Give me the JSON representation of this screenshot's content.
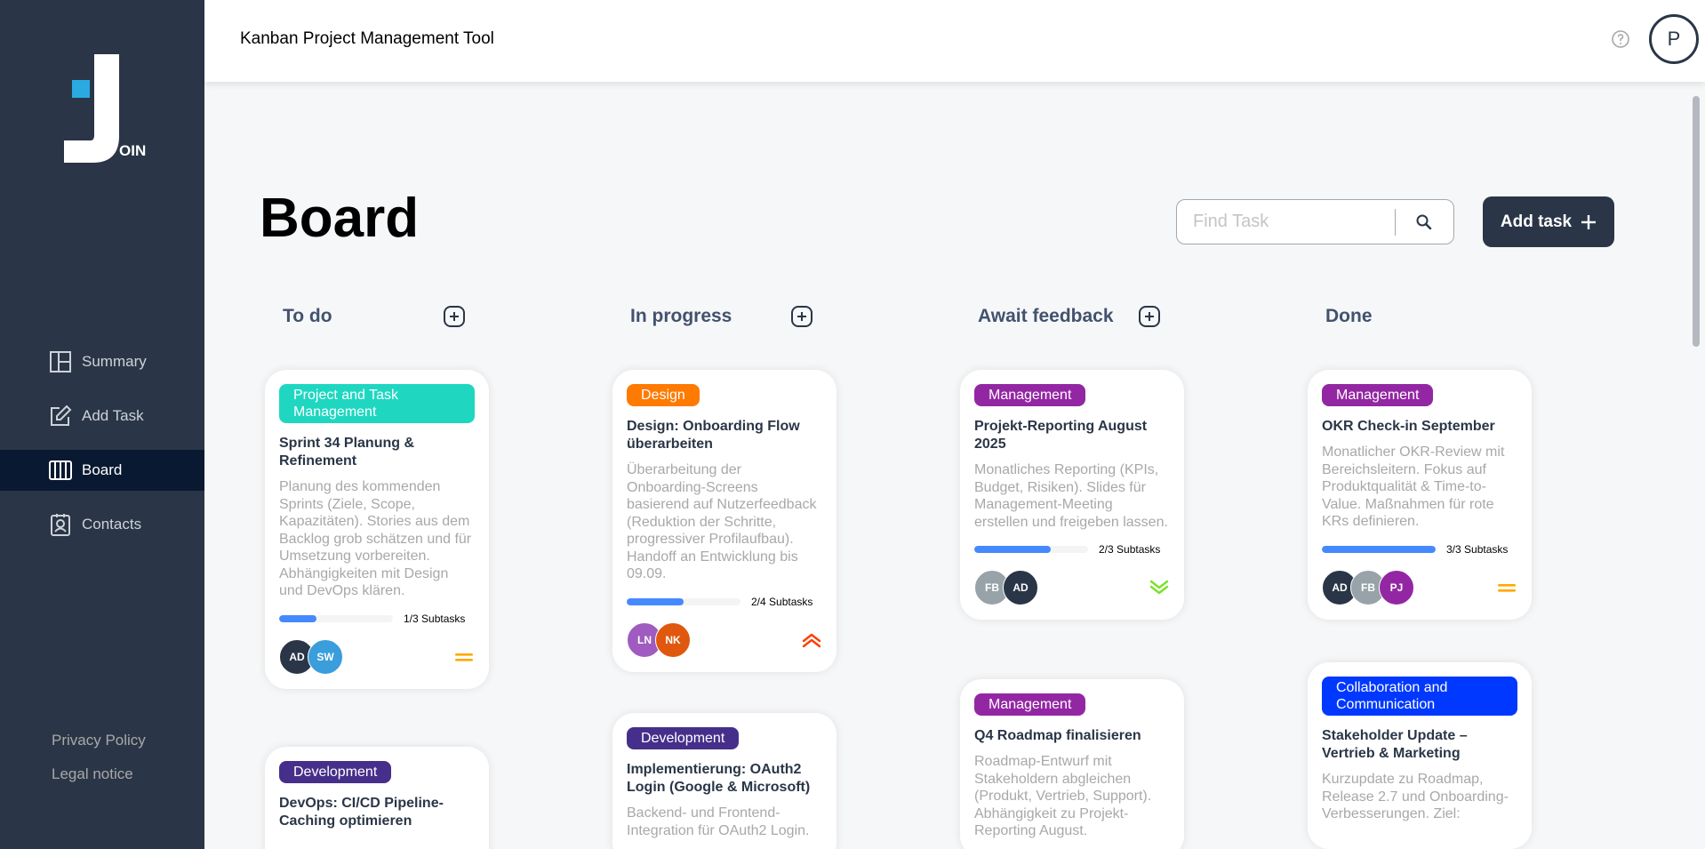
{
  "app": {
    "title": "Kanban Project Management Tool",
    "logo_text": "OIN",
    "user_initial": "P"
  },
  "sidebar": {
    "items": [
      {
        "label": "Summary",
        "icon": "summary-icon"
      },
      {
        "label": "Add Task",
        "icon": "edit-icon"
      },
      {
        "label": "Board",
        "icon": "board-icon",
        "active": true
      },
      {
        "label": "Contacts",
        "icon": "contacts-icon"
      }
    ],
    "legal": [
      "Privacy Policy",
      "Legal notice"
    ]
  },
  "board": {
    "title": "Board",
    "search_placeholder": "Find Task",
    "add_task_label": "Add task",
    "columns": [
      {
        "title": "To do"
      },
      {
        "title": "In progress"
      },
      {
        "title": "Await feedback"
      },
      {
        "title": "Done"
      }
    ]
  },
  "colors": {
    "sidebar": "#2a3647",
    "active": "#091931",
    "progress": "#4589ff",
    "prio_medium": "#ffa800",
    "prio_urgent": "#ff3d00",
    "prio_low": "#7ae229"
  },
  "cards": {
    "todo1": {
      "category": "Project and Task Management",
      "category_color": "#1fd7c1",
      "title": "Sprint 34 Planung & Refinement",
      "desc": "Planung des kommenden Sprints (Ziele, Scope, Kapazitäten). Stories aus dem Backlog grob schätzen und für Umsetzung vorbereiten. Abhängigkeiten mit Design und DevOps klären.",
      "subtasks": "1/3 Subtasks",
      "progress": 0.33,
      "assignees": [
        {
          "initials": "AD",
          "color": "#2a3647"
        },
        {
          "initials": "SW",
          "color": "#3a9ddc"
        }
      ],
      "priority": "medium"
    },
    "todo2": {
      "category": "Development",
      "category_color": "#462f8a",
      "title": "DevOps: CI/CD Pipeline-Caching optimieren"
    },
    "prog1": {
      "category": "Design",
      "category_color": "#ff7a00",
      "title": "Design: Onboarding Flow überarbeiten",
      "desc": "Überarbeitung der Onboarding-Screens basierend auf Nutzerfeedback (Reduktion der Schritte, progressiver Profilaufbau). Handoff an Entwicklung bis 09.09.",
      "subtasks": "2/4 Subtasks",
      "progress": 0.5,
      "assignees": [
        {
          "initials": "LN",
          "color": "#9f5bbf"
        },
        {
          "initials": "NK",
          "color": "#e0580e"
        }
      ],
      "priority": "urgent"
    },
    "prog2": {
      "category": "Development",
      "category_color": "#462f8a",
      "title": "Implementierung: OAuth2 Login (Google & Microsoft)",
      "desc": "Backend- und Frontend-Integration für OAuth2 Login."
    },
    "fb1": {
      "category": "Management",
      "category_color": "#9327a3",
      "title": "Projekt-Reporting August 2025",
      "desc": "Monatliches Reporting (KPIs, Budget, Risiken). Slides für Management-Meeting erstellen und freigeben lassen.",
      "subtasks": "2/3 Subtasks",
      "progress": 0.67,
      "assignees": [
        {
          "initials": "FB",
          "color": "#97a3a8"
        },
        {
          "initials": "AD",
          "color": "#2a3647"
        }
      ],
      "priority": "low"
    },
    "fb2": {
      "category": "Management",
      "category_color": "#9327a3",
      "title": "Q4 Roadmap finalisieren",
      "desc": "Roadmap-Entwurf mit Stakeholdern abgleichen (Produkt, Vertrieb, Support). Abhängigkeit zu Projekt-Reporting August."
    },
    "done1": {
      "category": "Management",
      "category_color": "#9327a3",
      "title": "OKR Check-in September",
      "desc": "Monatlicher OKR-Review mit Bereichsleitern. Fokus auf Produktqualität & Time-to-Value. Maßnahmen für rote KRs definieren.",
      "subtasks": "3/3 Subtasks",
      "progress": 1.0,
      "assignees": [
        {
          "initials": "AD",
          "color": "#2a3647"
        },
        {
          "initials": "FB",
          "color": "#97a3a8"
        },
        {
          "initials": "PJ",
          "color": "#9327a3"
        }
      ],
      "priority": "medium"
    },
    "done2": {
      "category": "Collaboration and Communication",
      "category_color": "#0038ff",
      "title": "Stakeholder Update – Vertrieb & Marketing",
      "desc": "Kurzupdate zu Roadmap, Release 2.7 und Onboarding-Verbesserungen. Ziel:"
    }
  }
}
